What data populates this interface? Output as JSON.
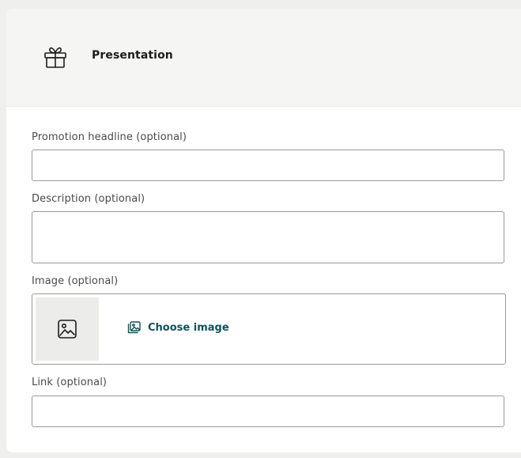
{
  "section": {
    "title": "Presentation",
    "icon": "gift-icon"
  },
  "fields": {
    "headline": {
      "label": "Promotion headline (optional)",
      "value": "",
      "placeholder": ""
    },
    "description": {
      "label": "Description (optional)",
      "value": "",
      "placeholder": ""
    },
    "image": {
      "label": "Image (optional)",
      "action_label": "Choose image",
      "placeholder_icon": "image-icon",
      "action_icon": "image-gallery-icon"
    },
    "link": {
      "label": "Link (optional)",
      "value": "",
      "placeholder": ""
    }
  },
  "colors": {
    "accent": "#12515a",
    "header_bg": "#f5f5f3",
    "page_bg": "#efefed"
  }
}
